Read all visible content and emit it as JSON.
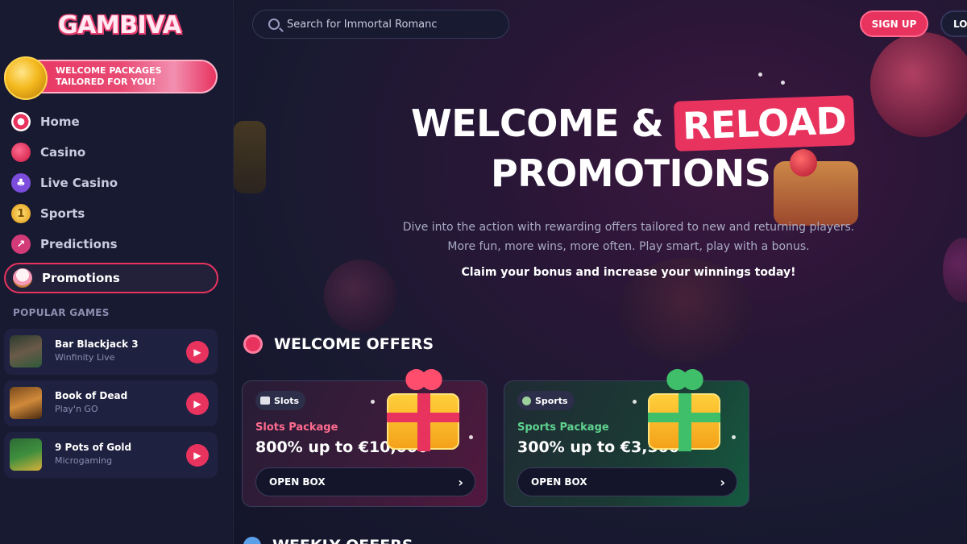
{
  "brand": {
    "logo_text": "GAMBIVA"
  },
  "sidebar": {
    "welcome_banner": "WELCOME PACKAGES TAILORED FOR YOU!",
    "nav": [
      {
        "label": "Home",
        "icon": "swirl-candy-icon",
        "color": "#e8335f"
      },
      {
        "label": "Casino",
        "icon": "cherry-icon",
        "color": "#e8335f"
      },
      {
        "label": "Live Casino",
        "icon": "club-icon",
        "color": "#8b5cf6"
      },
      {
        "label": "Sports",
        "icon": "medal-icon",
        "color": "#f4b91e"
      },
      {
        "label": "Predictions",
        "icon": "trend-arrow-icon",
        "color": "#e8335f"
      },
      {
        "label": "Promotions",
        "icon": "cupcake-icon",
        "color": "#f7a9c0",
        "active": true
      }
    ],
    "popular_title": "POPULAR GAMES",
    "popular_games": [
      {
        "name": "Bar Blackjack 3",
        "provider": "Winfinity Live"
      },
      {
        "name": "Book of Dead",
        "provider": "Play'n GO"
      },
      {
        "name": "9 Pots of Gold",
        "provider": "Microgaming"
      }
    ]
  },
  "header": {
    "search_label": "Search for",
    "search_value": "Immortal Romanc",
    "signup_label": "SIGN UP",
    "login_label": "LO"
  },
  "hero": {
    "line1_a": "WELCOME &",
    "line1_highlight": "RELOAD",
    "line2": "PROMOTIONS",
    "desc_line1": "Dive into the action with rewarding offers tailored to new and returning players.",
    "desc_line2": "More fun, more wins, more often. Play smart, play with a bonus.",
    "claim": "Claim your bonus and increase your winnings today!"
  },
  "welcome_offers": {
    "title": "WELCOME OFFERS",
    "offers": [
      {
        "tag": "Slots",
        "package": "Slots Package",
        "amount": "800% up to €10,000",
        "button": "OPEN BOX"
      },
      {
        "tag": "Sports",
        "package": "Sports Package",
        "amount": "300% up to €3,500",
        "button": "OPEN BOX"
      }
    ]
  },
  "next_section": {
    "title": "WEEKLY OFFERS"
  },
  "colors": {
    "accent": "#e8335f",
    "sidebar_bg": "#181a31",
    "page_bg": "#14152b"
  }
}
